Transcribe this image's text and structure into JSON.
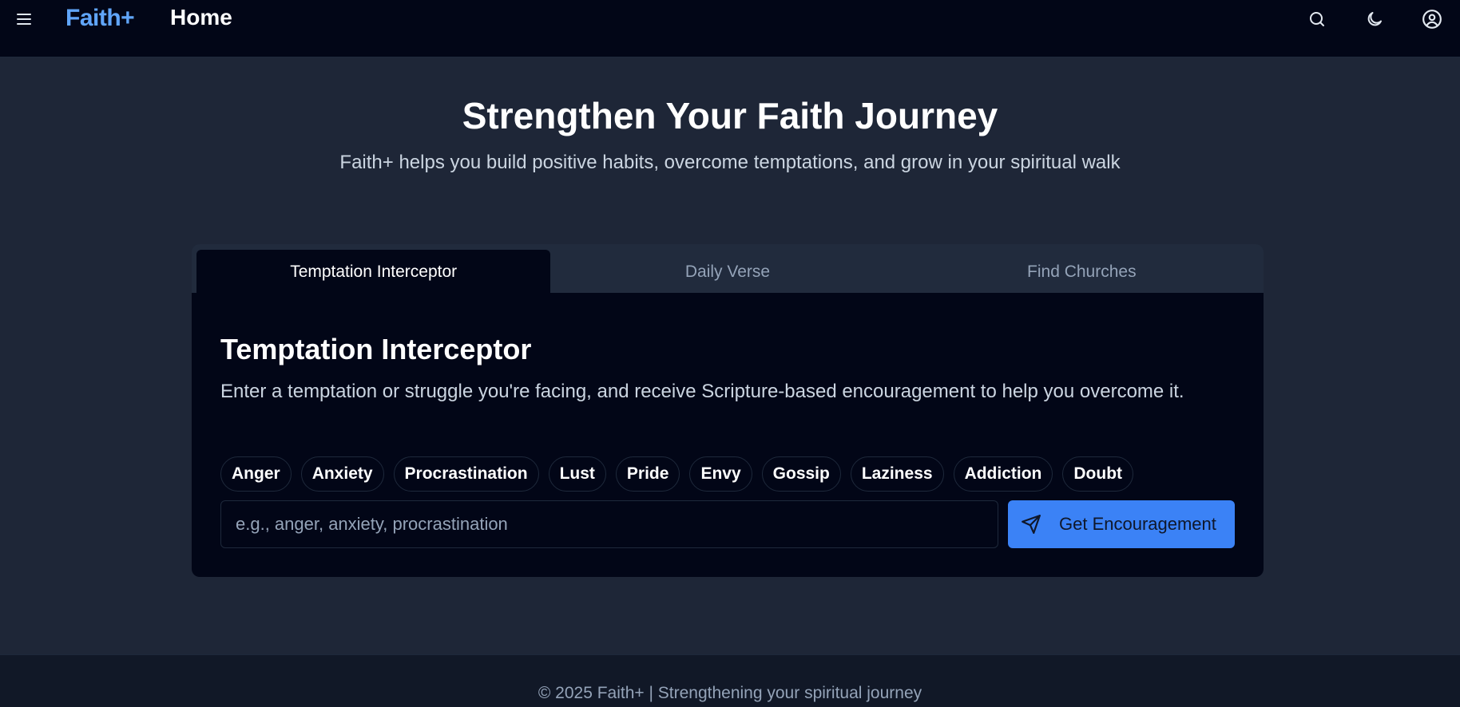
{
  "header": {
    "brand": "Faith+",
    "page_title": "Home",
    "icons": [
      "menu-icon",
      "search-icon",
      "moon-icon",
      "user-circle-icon"
    ]
  },
  "hero": {
    "title": "Strengthen Your Faith Journey",
    "subtitle": "Faith+ helps you build positive habits, overcome temptations, and grow in your spiritual walk"
  },
  "tabs": [
    {
      "label": "Temptation Interceptor",
      "active": true
    },
    {
      "label": "Daily Verse",
      "active": false
    },
    {
      "label": "Find Churches",
      "active": false
    }
  ],
  "panel": {
    "title": "Temptation Interceptor",
    "description": "Enter a temptation or struggle you're facing, and receive Scripture-based encouragement to help you overcome it.",
    "chips": [
      "Anger",
      "Anxiety",
      "Procrastination",
      "Lust",
      "Pride",
      "Envy",
      "Gossip",
      "Laziness",
      "Addiction",
      "Doubt"
    ],
    "input": {
      "value": "",
      "placeholder": "e.g., anger, anxiety, procrastination"
    },
    "submit_label": "Get Encouragement"
  },
  "footer": {
    "text": "© 2025 Faith+ | Strengthening your spiritual journey"
  },
  "colors": {
    "accent": "#3b82f6",
    "brand": "#60a5fa",
    "background": "#1e2637",
    "panel": "#020617"
  }
}
